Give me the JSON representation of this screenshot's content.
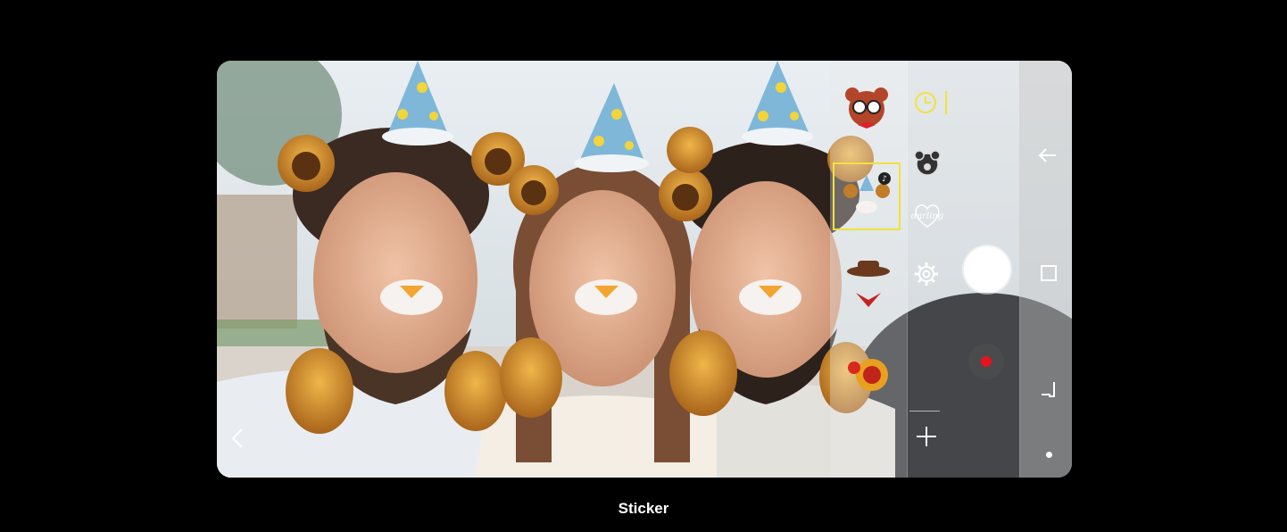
{
  "caption": "Sticker",
  "colors": {
    "accent": "#f2e23a",
    "record": "#e8121d",
    "background": "#000000"
  },
  "sticker_tray": [
    {
      "name": "bear-mask-sticker"
    },
    {
      "name": "tiger-party-sticker",
      "selected": true
    },
    {
      "name": "cowboy-sticker"
    },
    {
      "name": "fireworks-sticker"
    }
  ],
  "mode_icons": [
    "timer-icon",
    "bear-icon",
    "darling-heart-icon",
    "settings-icon",
    "add-icon"
  ],
  "darling_text": "darling",
  "nav_icons": [
    "back-icon",
    "recents-icon",
    "return-icon",
    "home-dot-icon"
  ]
}
